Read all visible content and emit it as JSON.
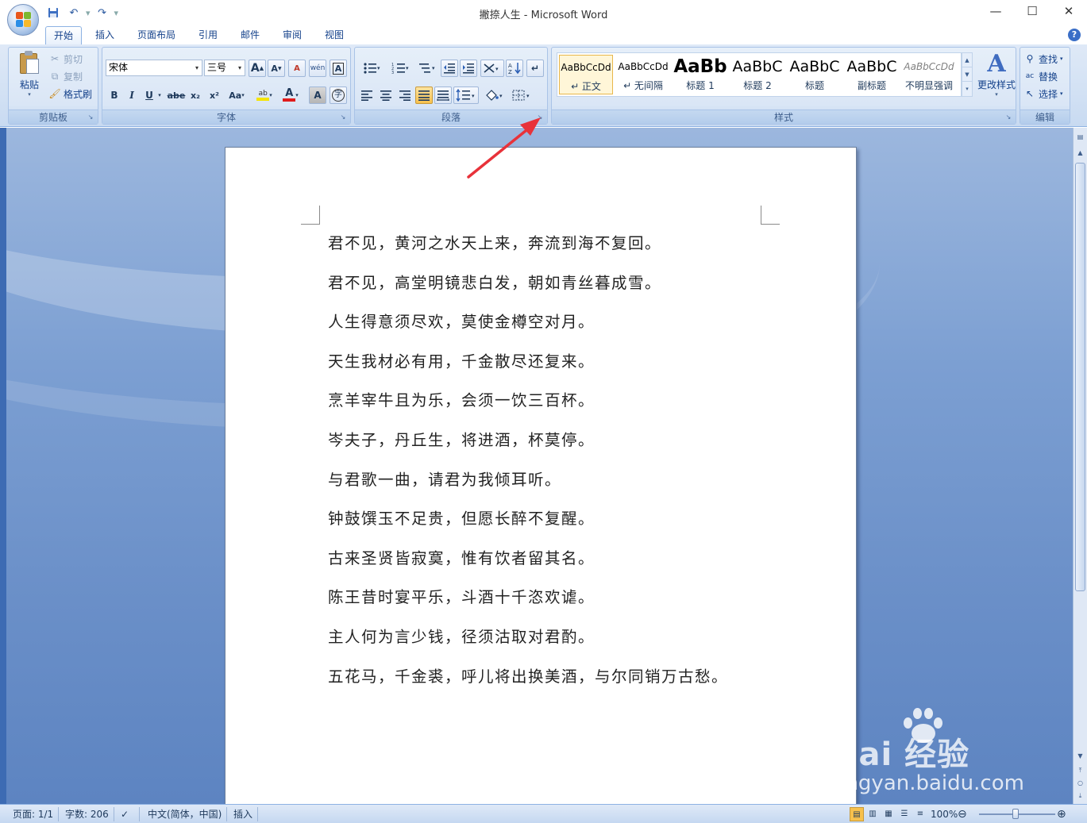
{
  "window": {
    "title": "撇捺人生 - Microsoft Word",
    "minimize_glyph": "—",
    "maximize_glyph": "☐",
    "close_glyph": "✕"
  },
  "qat": {
    "save_icon": "save-icon",
    "undo_icon": "undo-icon",
    "redo_icon": "redo-icon",
    "customize_glyph": "▾"
  },
  "tabs": [
    "开始",
    "插入",
    "页面布局",
    "引用",
    "邮件",
    "审阅",
    "视图"
  ],
  "help_glyph": "?",
  "clipboard": {
    "paste": "粘贴",
    "cut": "剪切",
    "copy": "复制",
    "format_painter": "格式刷",
    "group_label": "剪贴板"
  },
  "font": {
    "font_name": "宋体",
    "font_size": "三号",
    "grow": "A",
    "shrink": "A",
    "clear": "A",
    "phonetic": "wén",
    "border": "A",
    "bold": "B",
    "italic": "I",
    "underline": "U",
    "strike": "abe",
    "subscript": "x₂",
    "superscript": "x²",
    "change_case": "Aa",
    "highlight": "ab",
    "font_color": "A",
    "shading": "A",
    "enclose": "字",
    "group_label": "字体"
  },
  "paragraph": {
    "group_label": "段落"
  },
  "styles": {
    "items": [
      {
        "sample": "AaBbCcDd",
        "name": "↵ 正文",
        "selected": true
      },
      {
        "sample": "AaBbCcDd",
        "name": "↵ 无间隔",
        "selected": false
      },
      {
        "sample": "AaBb",
        "name": "标题 1",
        "selected": false
      },
      {
        "sample": "AaBbC",
        "name": "标题 2",
        "selected": false
      },
      {
        "sample": "AaBbC",
        "name": "标题",
        "selected": false
      },
      {
        "sample": "AaBbC",
        "name": "副标题",
        "selected": false
      },
      {
        "sample": "AaBbCcDd",
        "name": "不明显强调",
        "selected": false
      }
    ],
    "change_styles": "更改样式",
    "group_label": "样式"
  },
  "editing": {
    "find": "查找",
    "replace": "替换",
    "select": "选择",
    "group_label": "编辑"
  },
  "document": {
    "lines": [
      "君不见，黄河之水天上来，奔流到海不复回。",
      "君不见，高堂明镜悲白发，朝如青丝暮成雪。",
      "人生得意须尽欢，莫使金樽空对月。",
      "天生我材必有用，千金散尽还复来。",
      "烹羊宰牛且为乐，会须一饮三百杯。",
      "岑夫子，丹丘生，将进酒，杯莫停。",
      "与君歌一曲，请君为我倾耳听。",
      "钟鼓馔玉不足贵，但愿长醉不复醒。",
      "古来圣贤皆寂寞，惟有饮者留其名。",
      "陈王昔时宴平乐，斗酒十千恣欢谑。",
      "主人何为言少钱，径须沽取对君酌。",
      "五花马，千金裘，呼儿将出换美酒，与尔同销万古愁。"
    ]
  },
  "watermark": {
    "brand": "Bai  经验",
    "url": "jingyan.baidu.com"
  },
  "status": {
    "page": "页面: 1/1",
    "words": "字数: 206",
    "language": "中文(简体，中国)",
    "mode": "插入",
    "zoom": "100%",
    "zoom_out": "⊖",
    "zoom_in": "⊕"
  },
  "colors": {
    "accent": "#15428b",
    "annotation_arrow": "#e8323a",
    "highlight_yellow": "#f5e400",
    "font_color_red": "#e01b1b"
  }
}
